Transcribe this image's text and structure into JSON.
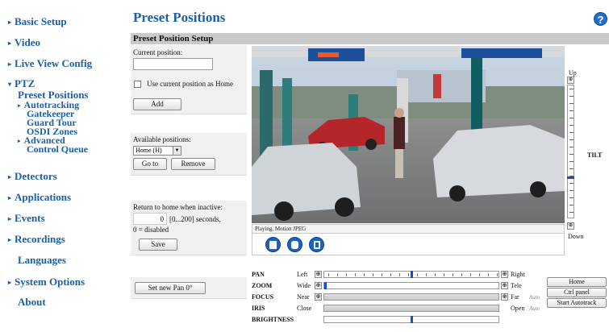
{
  "nav": {
    "basic_setup": "Basic Setup",
    "video": "Video",
    "live_view_config": "Live View Config",
    "ptz": "PTZ",
    "ptz_items": [
      "Preset Positions",
      "Autotracking",
      "Gatekeeper",
      "Guard Tour",
      "OSDI Zones",
      "Advanced",
      "Control Queue"
    ],
    "detectors": "Detectors",
    "applications": "Applications",
    "events": "Events",
    "recordings": "Recordings",
    "languages": "Languages",
    "system_options": "System Options",
    "about": "About"
  },
  "header": {
    "title": "Preset Positions",
    "help_label": "?",
    "section": "Preset Position Setup"
  },
  "current": {
    "label": "Current position:",
    "value": "",
    "checkbox_label": "Use current position as Home",
    "checkbox_checked": false,
    "add": "Add"
  },
  "available": {
    "label": "Available positions:",
    "selected": "Home (H)",
    "goto": "Go to",
    "remove": "Remove"
  },
  "return_home": {
    "label": "Return to home when inactive:",
    "value": "0",
    "range": "[0...200] seconds,",
    "note": "0 = disabled",
    "save": "Save"
  },
  "pan_zero": "Set new Pan 0°",
  "video": {
    "status": "Playing, Motion JPEG",
    "buttons": [
      "stop-icon",
      "snapshot-icon",
      "record-icon"
    ]
  },
  "tilt": {
    "label": "TILT",
    "up": "Up",
    "down": "Down",
    "level": 0.7
  },
  "controls": [
    {
      "name": "PAN",
      "lo": "Left",
      "hi": "Right",
      "auto": "",
      "level": 0.5,
      "ticks": true,
      "steps": true
    },
    {
      "name": "ZOOM",
      "lo": "Wide",
      "hi": "Tele",
      "auto": "",
      "level": 0.0,
      "ticks": false,
      "steps": true
    },
    {
      "name": "FOCUS",
      "lo": "Near",
      "hi": "Far",
      "auto": "Auto",
      "level": null,
      "ticks": false,
      "steps": true
    },
    {
      "name": "IRIS",
      "lo": "Close",
      "hi": "Open",
      "auto": "Auto",
      "level": null,
      "ticks": false,
      "steps": false
    },
    {
      "name": "BRIGHTNESS",
      "lo": "",
      "hi": "",
      "auto": "",
      "level": 0.5,
      "ticks": false,
      "steps": false
    }
  ],
  "side_buttons": {
    "home": "Home",
    "ctrl_panel": "Ctrl panel",
    "autotrack": "Start Autotrack"
  },
  "colors": {
    "nav_link": "#1a5fa8",
    "section_bar": "#c9c9c9",
    "accent_blue": "#1a4fc4"
  }
}
